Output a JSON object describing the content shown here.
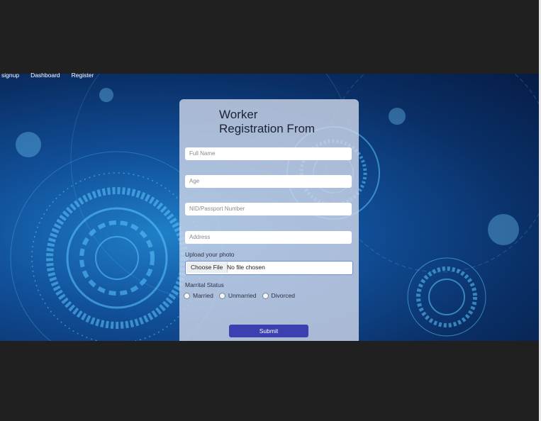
{
  "nav": {
    "items": [
      {
        "label": "signup"
      },
      {
        "label": "Dashboard"
      },
      {
        "label": "Register"
      }
    ]
  },
  "form": {
    "title_line1": "Worker",
    "title_line2": "Registration From",
    "fields": {
      "full_name_placeholder": "Full Name",
      "age_placeholder": "Age",
      "nid_placeholder": "NID/Passport Number",
      "address_placeholder": "Address"
    },
    "upload": {
      "label": "Upload your photo",
      "button_label": "Choose File",
      "status_text": "No file chosen"
    },
    "marital": {
      "label": "Marrital Status",
      "options": [
        {
          "label": "Married"
        },
        {
          "label": "Unmarried"
        },
        {
          "label": "Divorced"
        }
      ]
    },
    "submit_label": "Submit"
  },
  "colors": {
    "page_background": "#202020",
    "card_background": "#cdd6e8",
    "submit_button": "#3c3fb0",
    "hero_blue": "#11509a"
  }
}
